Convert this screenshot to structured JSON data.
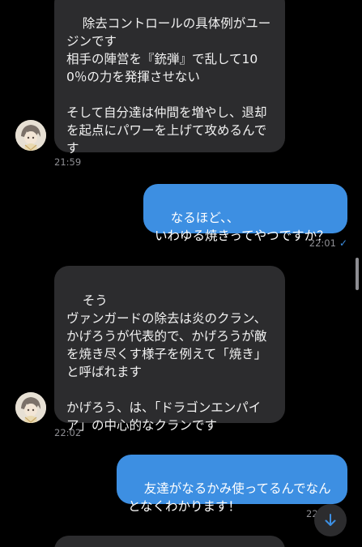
{
  "messages": [
    {
      "text": "除去コントロールの具体例がユージンです\n相手の陣営を『銃弾』で乱して100％の力を発揮させない\n\nそして自分達は仲間を増やし、退却を起点にパワーを上げて攻めるんです",
      "time": "21:59"
    },
    {
      "text": "なるほど、、\nいわゆる焼きってやつですか？",
      "time": "22:01"
    },
    {
      "text": "そう\nヴァンガードの除去は炎のクラン、かげろうが代表的で、かげろうが敵を焼き尽くす様子を例えて「焼き」と呼ばれます\n\nかげろう、は、「ドラゴンエンパイア」の中心的なクランです",
      "time": "22:02"
    },
    {
      "text": "友達がなるかみ使ってるんでなんとなくわかります！",
      "time": "22:"
    }
  ],
  "icons": {
    "read_check": "✓",
    "scroll_down": "arrow-down-icon",
    "avatar": "character-avatar"
  },
  "colors": {
    "background": "#000000",
    "incoming_bubble": "#2c2c2e",
    "outgoing_bubble": "#3d8fe2",
    "timestamp": "#8e8e93"
  }
}
